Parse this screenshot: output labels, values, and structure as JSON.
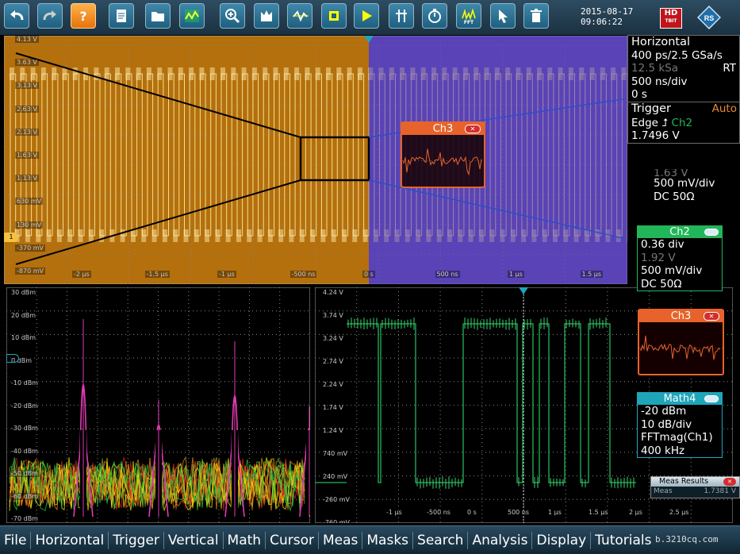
{
  "toolbar": {
    "buttons": [
      {
        "name": "undo-button",
        "icon": "undo-arrow-icon"
      },
      {
        "name": "redo-button",
        "icon": "redo-arrow-icon"
      },
      {
        "name": "help-button",
        "icon": "help-icon",
        "label": "?"
      },
      {
        "name": "report-button",
        "icon": "report-icon"
      },
      {
        "name": "open-file-button",
        "icon": "folder-icon"
      },
      {
        "name": "waveform-button",
        "icon": "waveform-icon"
      },
      {
        "name": "zoom-button",
        "icon": "zoom-icon"
      },
      {
        "name": "history-button",
        "icon": "history-icon"
      },
      {
        "name": "mask-button",
        "icon": "mask-icon"
      },
      {
        "name": "screen-capture-button",
        "icon": "chip-icon"
      },
      {
        "name": "play-button",
        "icon": "play-icon"
      },
      {
        "name": "cursor-measure-button",
        "icon": "cursor-measure-icon"
      },
      {
        "name": "timer-button",
        "icon": "stopwatch-icon"
      },
      {
        "name": "fft-button",
        "icon": "fft-icon",
        "label": "FFT"
      },
      {
        "name": "pointer-button",
        "icon": "pointer-icon"
      },
      {
        "name": "delete-button",
        "icon": "trash-icon"
      }
    ],
    "date": "2015-08-17",
    "time": "09:06:22",
    "hd_label": "HD",
    "hd_sub": "TBIT"
  },
  "colors": {
    "ch1": "#f5c23d",
    "ch2": "#21b65a",
    "ch3": "#e8622b",
    "math": "#1fa5b9",
    "accent_blue": "#1f5f80"
  },
  "top_panel": {
    "y_labels": [
      "4.13 V",
      "3.63 V",
      "3.13 V",
      "2.63 V",
      "2.13 V",
      "1.63 V",
      "1.13 V",
      "630 mV",
      "130 mV",
      "-370 mV",
      "-870 mV"
    ],
    "x_labels": [
      "-2 µs",
      "-1.5 µs",
      "-1 µs",
      "-500 ns",
      "0 s",
      "500 ns",
      "1 µs",
      "1.5 µs"
    ],
    "overlay_ch3_title": "Ch3"
  },
  "bottom_left": {
    "y_labels": [
      "30 dBm",
      "20 dBm",
      "10 dBm",
      "0 dBm",
      "-10 dBm",
      "-20 dBm",
      "-30 dBm",
      "-40 dBm",
      "-50 dBm",
      "-60 dBm",
      "-70 dBm"
    ]
  },
  "bottom_right": {
    "y_labels": [
      "4.24 V",
      "3.74 V",
      "3.24 V",
      "2.74 V",
      "2.24 V",
      "1.74 V",
      "1.24 V",
      "740 mV",
      "240 mV",
      "-260 mV",
      "-760 mV"
    ],
    "x_labels": [
      "-1 µs",
      "-500 ns",
      "0 s",
      "500 ns",
      "1 µs",
      "1.5 µs",
      "2 µs",
      "2.5 µs"
    ]
  },
  "horizontal": {
    "title": "Horizontal",
    "rate": "400 ps/2.5 GSa/s",
    "record": "12.5 kSa",
    "mode": "RT",
    "scale": "500 ns/div",
    "position": "0 s"
  },
  "trigger": {
    "title": "Trigger",
    "mode": "Auto",
    "type": "Edge",
    "source": "Ch2",
    "level": "1.7496 V"
  },
  "ch1_box": {
    "offset": "1.63 V",
    "scale": "500 mV/div",
    "coupling": "DC 50Ω"
  },
  "ch2_box": {
    "title": "Ch2",
    "div": "0.36 div",
    "offset": "1.92 V",
    "scale": "500 mV/div",
    "coupling": "DC 50Ω"
  },
  "ch3_box": {
    "title": "Ch3"
  },
  "math4_box": {
    "title": "Math4",
    "level": "-20 dBm",
    "scale": "10 dB/div",
    "expr": "FFTmag(Ch1)",
    "span": "400 kHz"
  },
  "meas_results": {
    "title": "Meas Results",
    "label": "Meas",
    "value": "1.7381 V"
  },
  "menu": [
    "File",
    "Horizontal",
    "Trigger",
    "Vertical",
    "Math",
    "Cursor",
    "Meas",
    "Masks",
    "Search",
    "Analysis",
    "Display",
    "Tutorials"
  ],
  "watermark": "b.3210cq.com"
}
